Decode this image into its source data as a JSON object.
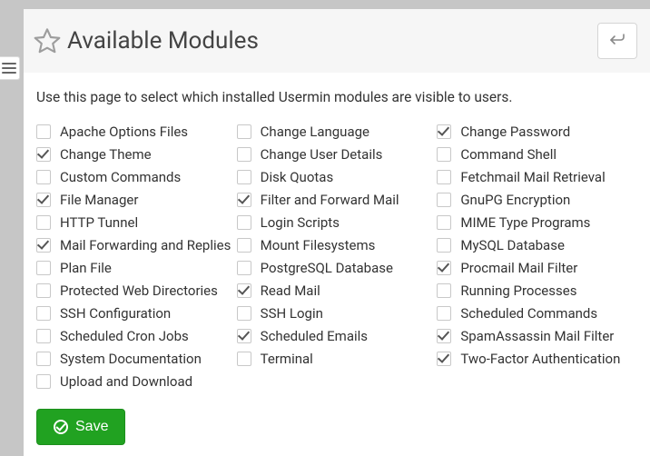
{
  "page": {
    "title": "Available Modules",
    "description": "Use this page to select which installed Usermin modules are visible to users.",
    "save_label": "Save",
    "icons": {
      "favorite": "star-icon",
      "back": "return-icon",
      "menu": "hamburger-icon",
      "save": "check-circle-icon"
    }
  },
  "modules": {
    "col1": [
      {
        "label": "Apache Options Files",
        "checked": false
      },
      {
        "label": "Change Theme",
        "checked": true
      },
      {
        "label": "Custom Commands",
        "checked": false
      },
      {
        "label": "File Manager",
        "checked": true
      },
      {
        "label": "HTTP Tunnel",
        "checked": false
      },
      {
        "label": "Mail Forwarding and Replies",
        "checked": true
      },
      {
        "label": "Plan File",
        "checked": false
      },
      {
        "label": "Protected Web Directories",
        "checked": false
      },
      {
        "label": "SSH Configuration",
        "checked": false
      },
      {
        "label": "Scheduled Cron Jobs",
        "checked": false
      },
      {
        "label": "System Documentation",
        "checked": false
      },
      {
        "label": "Upload and Download",
        "checked": false
      }
    ],
    "col2": [
      {
        "label": "Change Language",
        "checked": false
      },
      {
        "label": "Change User Details",
        "checked": false
      },
      {
        "label": "Disk Quotas",
        "checked": false
      },
      {
        "label": "Filter and Forward Mail",
        "checked": true
      },
      {
        "label": "Login Scripts",
        "checked": false
      },
      {
        "label": "Mount Filesystems",
        "checked": false
      },
      {
        "label": "PostgreSQL Database",
        "checked": false
      },
      {
        "label": "Read Mail",
        "checked": true
      },
      {
        "label": "SSH Login",
        "checked": false
      },
      {
        "label": "Scheduled Emails",
        "checked": true
      },
      {
        "label": "Terminal",
        "checked": false
      }
    ],
    "col3": [
      {
        "label": "Change Password",
        "checked": true
      },
      {
        "label": "Command Shell",
        "checked": false
      },
      {
        "label": "Fetchmail Mail Retrieval",
        "checked": false
      },
      {
        "label": "GnuPG Encryption",
        "checked": false
      },
      {
        "label": "MIME Type Programs",
        "checked": false
      },
      {
        "label": "MySQL Database",
        "checked": false
      },
      {
        "label": "Procmail Mail Filter",
        "checked": true
      },
      {
        "label": "Running Processes",
        "checked": false
      },
      {
        "label": "Scheduled Commands",
        "checked": false
      },
      {
        "label": "SpamAssassin Mail Filter",
        "checked": true
      },
      {
        "label": "Two-Factor Authentication",
        "checked": true
      }
    ]
  }
}
